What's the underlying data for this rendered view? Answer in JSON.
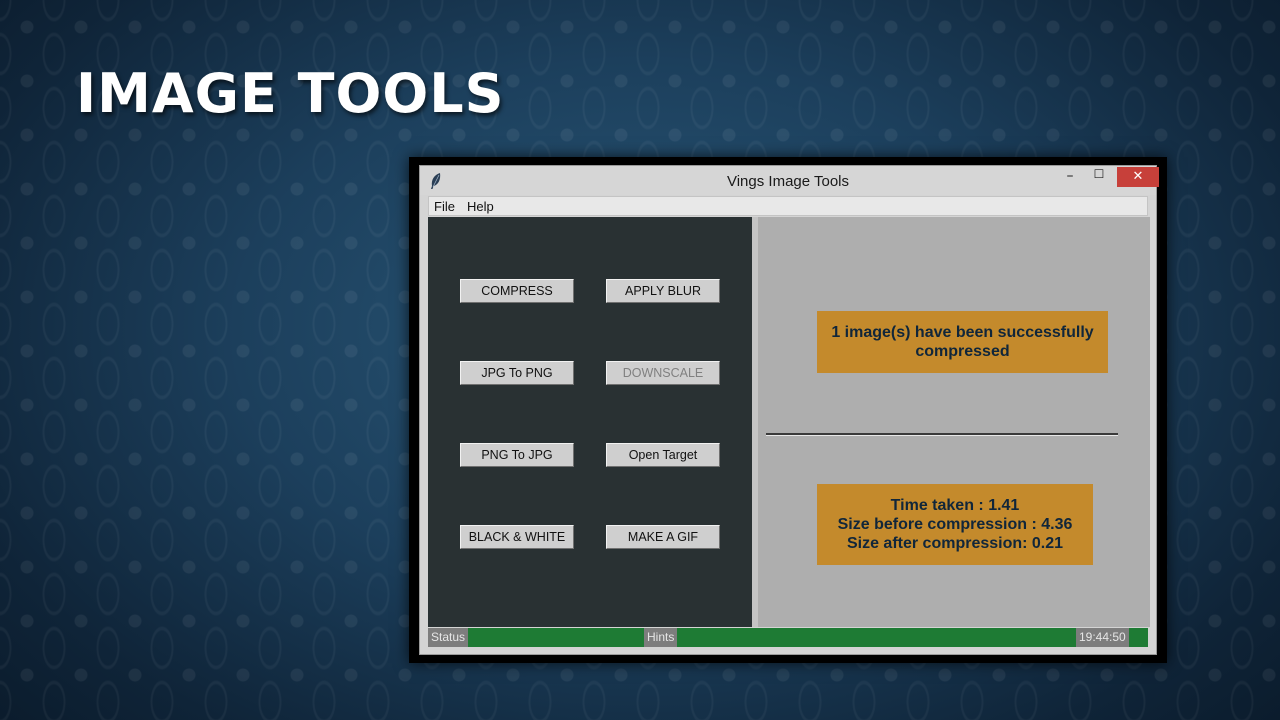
{
  "slide": {
    "title": "IMAGE TOOLS"
  },
  "window": {
    "title": "Vings Image Tools",
    "controls": {
      "minimize": "–",
      "maximize": "☐",
      "close": "✕"
    }
  },
  "menu": {
    "items": [
      "File",
      "Help"
    ]
  },
  "tools": {
    "compress": "COMPRESS",
    "apply_blur": "APPLY BLUR",
    "jpg_to_png": "JPG To PNG",
    "downscale": "DOWNSCALE",
    "png_to_jpg": "PNG To JPG",
    "open_target": "Open Target",
    "black_white": "BLACK & WHITE",
    "make_gif": "MAKE A GIF"
  },
  "messages": {
    "success": [
      "1 image(s) have been successfully",
      "compressed"
    ],
    "stats": [
      "Time taken : 1.41",
      "Size before compression : 4.36",
      "Size after compression: 0.21"
    ]
  },
  "statusbar": {
    "status_label": "Status",
    "hints_label": "Hints",
    "clock": "19:44:50"
  },
  "colors": {
    "left_panel": "#293133",
    "right_panel": "#aeaeae",
    "message_bg": "#c48a2c",
    "status_green": "#1e7b34",
    "close_red": "#c7403a"
  },
  "icons": {
    "app": "feather-icon"
  }
}
